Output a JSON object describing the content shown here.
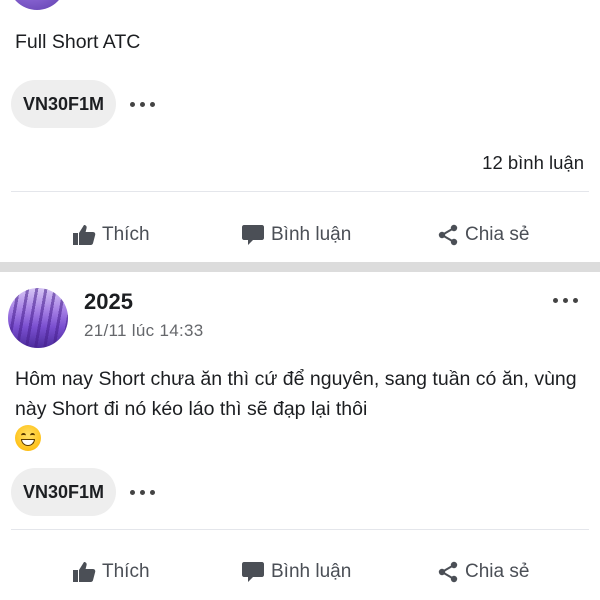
{
  "post1": {
    "text": "Full Short ATC",
    "tag": "VN30F1M",
    "comments_count": "12 bình luận"
  },
  "post2": {
    "author": "2025",
    "timestamp": "21/11 lúc 14:33",
    "text": "Hôm nay Short chưa ăn thì cứ để nguyên, sang tuần có ăn, vùng này Short đi nó kéo láo thì sẽ đạp lại thôi",
    "emoji": "grinning-face",
    "tag": "VN30F1M"
  },
  "actions": {
    "like": "Thích",
    "comment": "Bình luận",
    "share": "Chia sẻ"
  },
  "icons": [
    "thumbs-up-icon",
    "comment-icon",
    "share-icon",
    "more-icon"
  ]
}
